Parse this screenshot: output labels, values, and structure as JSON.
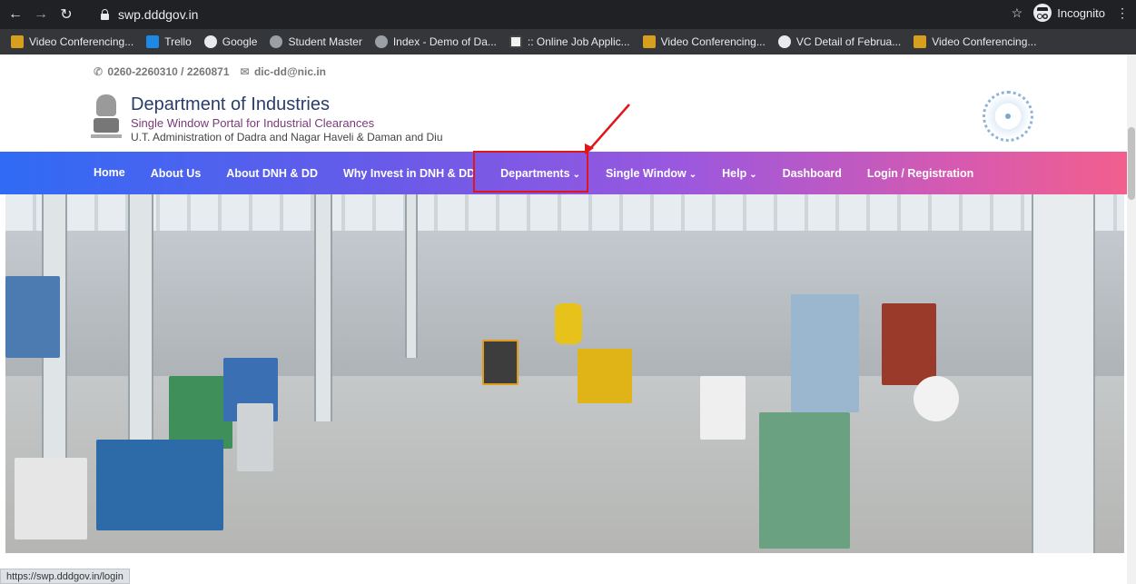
{
  "browser": {
    "url": "swp.dddgov.in",
    "incognito_label": "Incognito",
    "status_url": "https://swp.dddgov.in/login",
    "bookmarks": [
      {
        "label": "Video Conferencing...",
        "icon": "vc"
      },
      {
        "label": "Trello",
        "icon": "trello"
      },
      {
        "label": "Google",
        "icon": "google"
      },
      {
        "label": "Student Master",
        "icon": "globe"
      },
      {
        "label": "Index - Demo of Da...",
        "icon": "globe"
      },
      {
        "label": ":: Online Job Applic...",
        "icon": "job"
      },
      {
        "label": "Video Conferencing...",
        "icon": "vc"
      },
      {
        "label": "VC Detail of Februa...",
        "icon": "google"
      },
      {
        "label": "Video Conferencing...",
        "icon": "vc"
      }
    ]
  },
  "header": {
    "phone": "0260-2260310 / 2260871",
    "email": "dic-dd@nic.in",
    "title": "Department of Industries",
    "subtitle": "Single Window Portal for Industrial Clearances",
    "ut": "U.T. Administration of Dadra and Nagar Haveli & Daman and Diu"
  },
  "nav": {
    "items": [
      {
        "label": "Home"
      },
      {
        "label": "About Us"
      },
      {
        "label": "About DNH & DD"
      },
      {
        "label": "Why Invest in DNH & DD"
      },
      {
        "label": "Departments",
        "dropdown": true
      },
      {
        "label": "Single Window",
        "dropdown": true
      },
      {
        "label": "Help",
        "dropdown": true
      },
      {
        "label": "Dashboard"
      },
      {
        "label": "Login / Registration"
      }
    ]
  },
  "colors": {
    "annotation": "#e0161b",
    "nav_start": "#2f6bf5",
    "nav_end": "#f25f8e"
  }
}
